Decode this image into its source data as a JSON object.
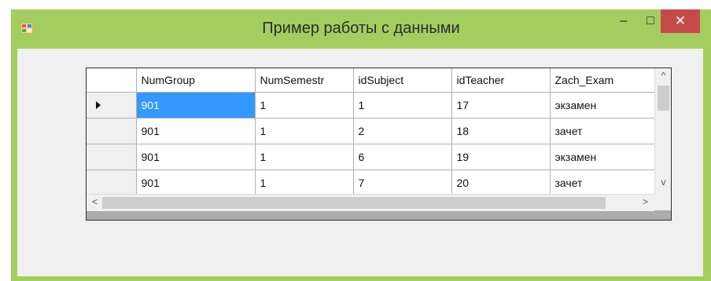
{
  "window": {
    "title": "Пример работы с данными",
    "minimize": "–",
    "maximize": "□",
    "close": "✕"
  },
  "grid": {
    "columns": [
      "NumGroup",
      "NumSemestr",
      "idSubject",
      "idTeacher",
      "Zach_Exam"
    ],
    "rows": [
      [
        "901",
        "1",
        "1",
        "17",
        "экзамен"
      ],
      [
        "901",
        "1",
        "2",
        "18",
        "зачет"
      ],
      [
        "901",
        "1",
        "6",
        "19",
        "экзамен"
      ],
      [
        "901",
        "1",
        "7",
        "20",
        "зачет"
      ]
    ],
    "current_row": 0,
    "selected_cell": "NumGroup"
  },
  "scrollbars": {
    "up": "^",
    "down": "v",
    "left": "<",
    "right": ">"
  },
  "colors": {
    "frame": "#a4cd60",
    "close": "#c74a4a",
    "selection": "#3399ff"
  }
}
